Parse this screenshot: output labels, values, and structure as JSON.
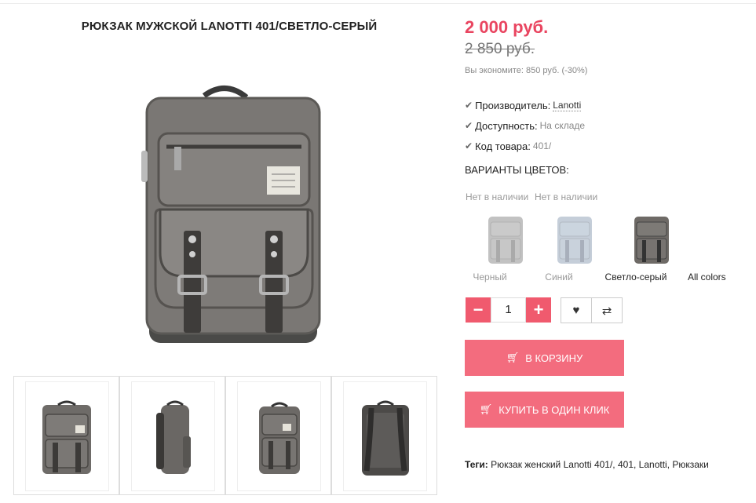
{
  "product": {
    "title": "РЮКЗАК МУЖСКОЙ LANOTTI 401/СВЕТЛО-СЕРЫЙ",
    "price": "2 000 руб.",
    "old_price": "2 850 руб.",
    "economy": "Вы экономите: 850 руб. (-30%)"
  },
  "specs": [
    {
      "label": "Производитель:",
      "value": "Lanotti",
      "style": "link"
    },
    {
      "label": "Доступность:",
      "value": "На складе",
      "style": "muted"
    },
    {
      "label": "Код товара:",
      "value": "401/",
      "style": "muted"
    }
  ],
  "variants": {
    "heading": "ВАРИАНТЫ ЦВЕТОВ:",
    "items": [
      {
        "stock": "Нет в наличии",
        "name": "Черный",
        "color": "#7d7d7d",
        "available": false
      },
      {
        "stock": "Нет в наличии",
        "name": "Синий",
        "color": "#7f95ad",
        "available": false
      },
      {
        "stock": "",
        "name": "Светло-серый",
        "color": "#6e6a66",
        "available": true
      }
    ],
    "all_colors": "All colors"
  },
  "quantity": {
    "value": "1",
    "minus": "−",
    "plus": "+"
  },
  "icons": {
    "wishlist": "heart-icon",
    "compare": "compare-arrows-icon",
    "cart": "cart-icon"
  },
  "buttons": {
    "cart": "В КОРЗИНУ",
    "one_click": "КУПИТЬ В ОДИН КЛИК"
  },
  "tags": {
    "label": "Теги:",
    "value": "Рюкзак женский Lanotti 401/, 401, Lanotti, Рюкзаки"
  },
  "colors": {
    "accent": "#e94560",
    "button": "#f36c7e",
    "qty": "#f05a6e"
  }
}
